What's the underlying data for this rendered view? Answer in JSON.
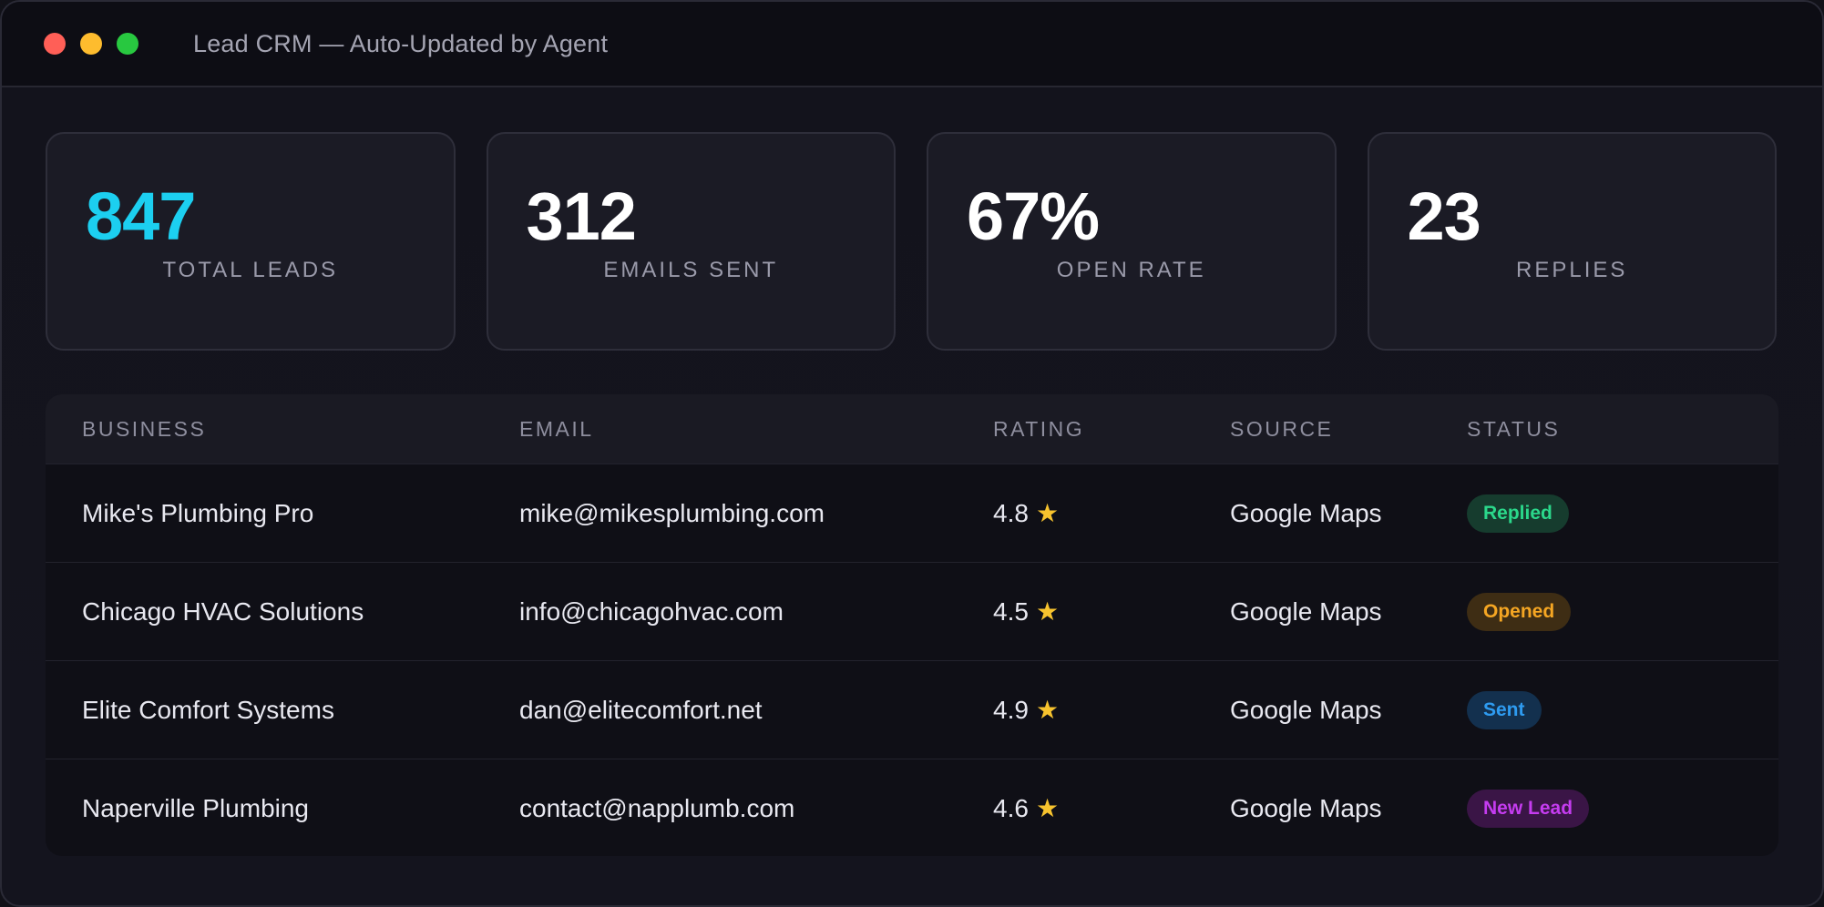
{
  "window": {
    "title": "Lead CRM — Auto-Updated by Agent"
  },
  "stats": [
    {
      "value": "847",
      "label": "TOTAL LEADS",
      "color": "#1ccff0"
    },
    {
      "value": "312",
      "label": "EMAILS SENT",
      "color": "#ffffff"
    },
    {
      "value": "67%",
      "label": "OPEN RATE",
      "color": "#ffffff"
    },
    {
      "value": "23",
      "label": "REPLIES",
      "color": "#ffffff"
    }
  ],
  "table": {
    "headers": [
      "BUSINESS",
      "EMAIL",
      "RATING",
      "SOURCE",
      "STATUS"
    ],
    "rows": [
      {
        "business": "Mike's Plumbing Pro",
        "email": "mike@mikesplumbing.com",
        "rating": "4.8",
        "source": "Google Maps",
        "status": "Replied",
        "status_color": "#2bd88b"
      },
      {
        "business": "Chicago HVAC Solutions",
        "email": "info@chicagohvac.com",
        "rating": "4.5",
        "source": "Google Maps",
        "status": "Opened",
        "status_color": "#f5a623"
      },
      {
        "business": "Elite Comfort Systems",
        "email": "dan@elitecomfort.net",
        "rating": "4.9",
        "source": "Google Maps",
        "status": "Sent",
        "status_color": "#2e9bf0"
      },
      {
        "business": "Naperville Plumbing",
        "email": "contact@napplumb.com",
        "rating": "4.6",
        "source": "Google Maps",
        "status": "New Lead",
        "status_color": "#c53cf0"
      }
    ]
  },
  "icons": {
    "rating": "star-icon"
  }
}
